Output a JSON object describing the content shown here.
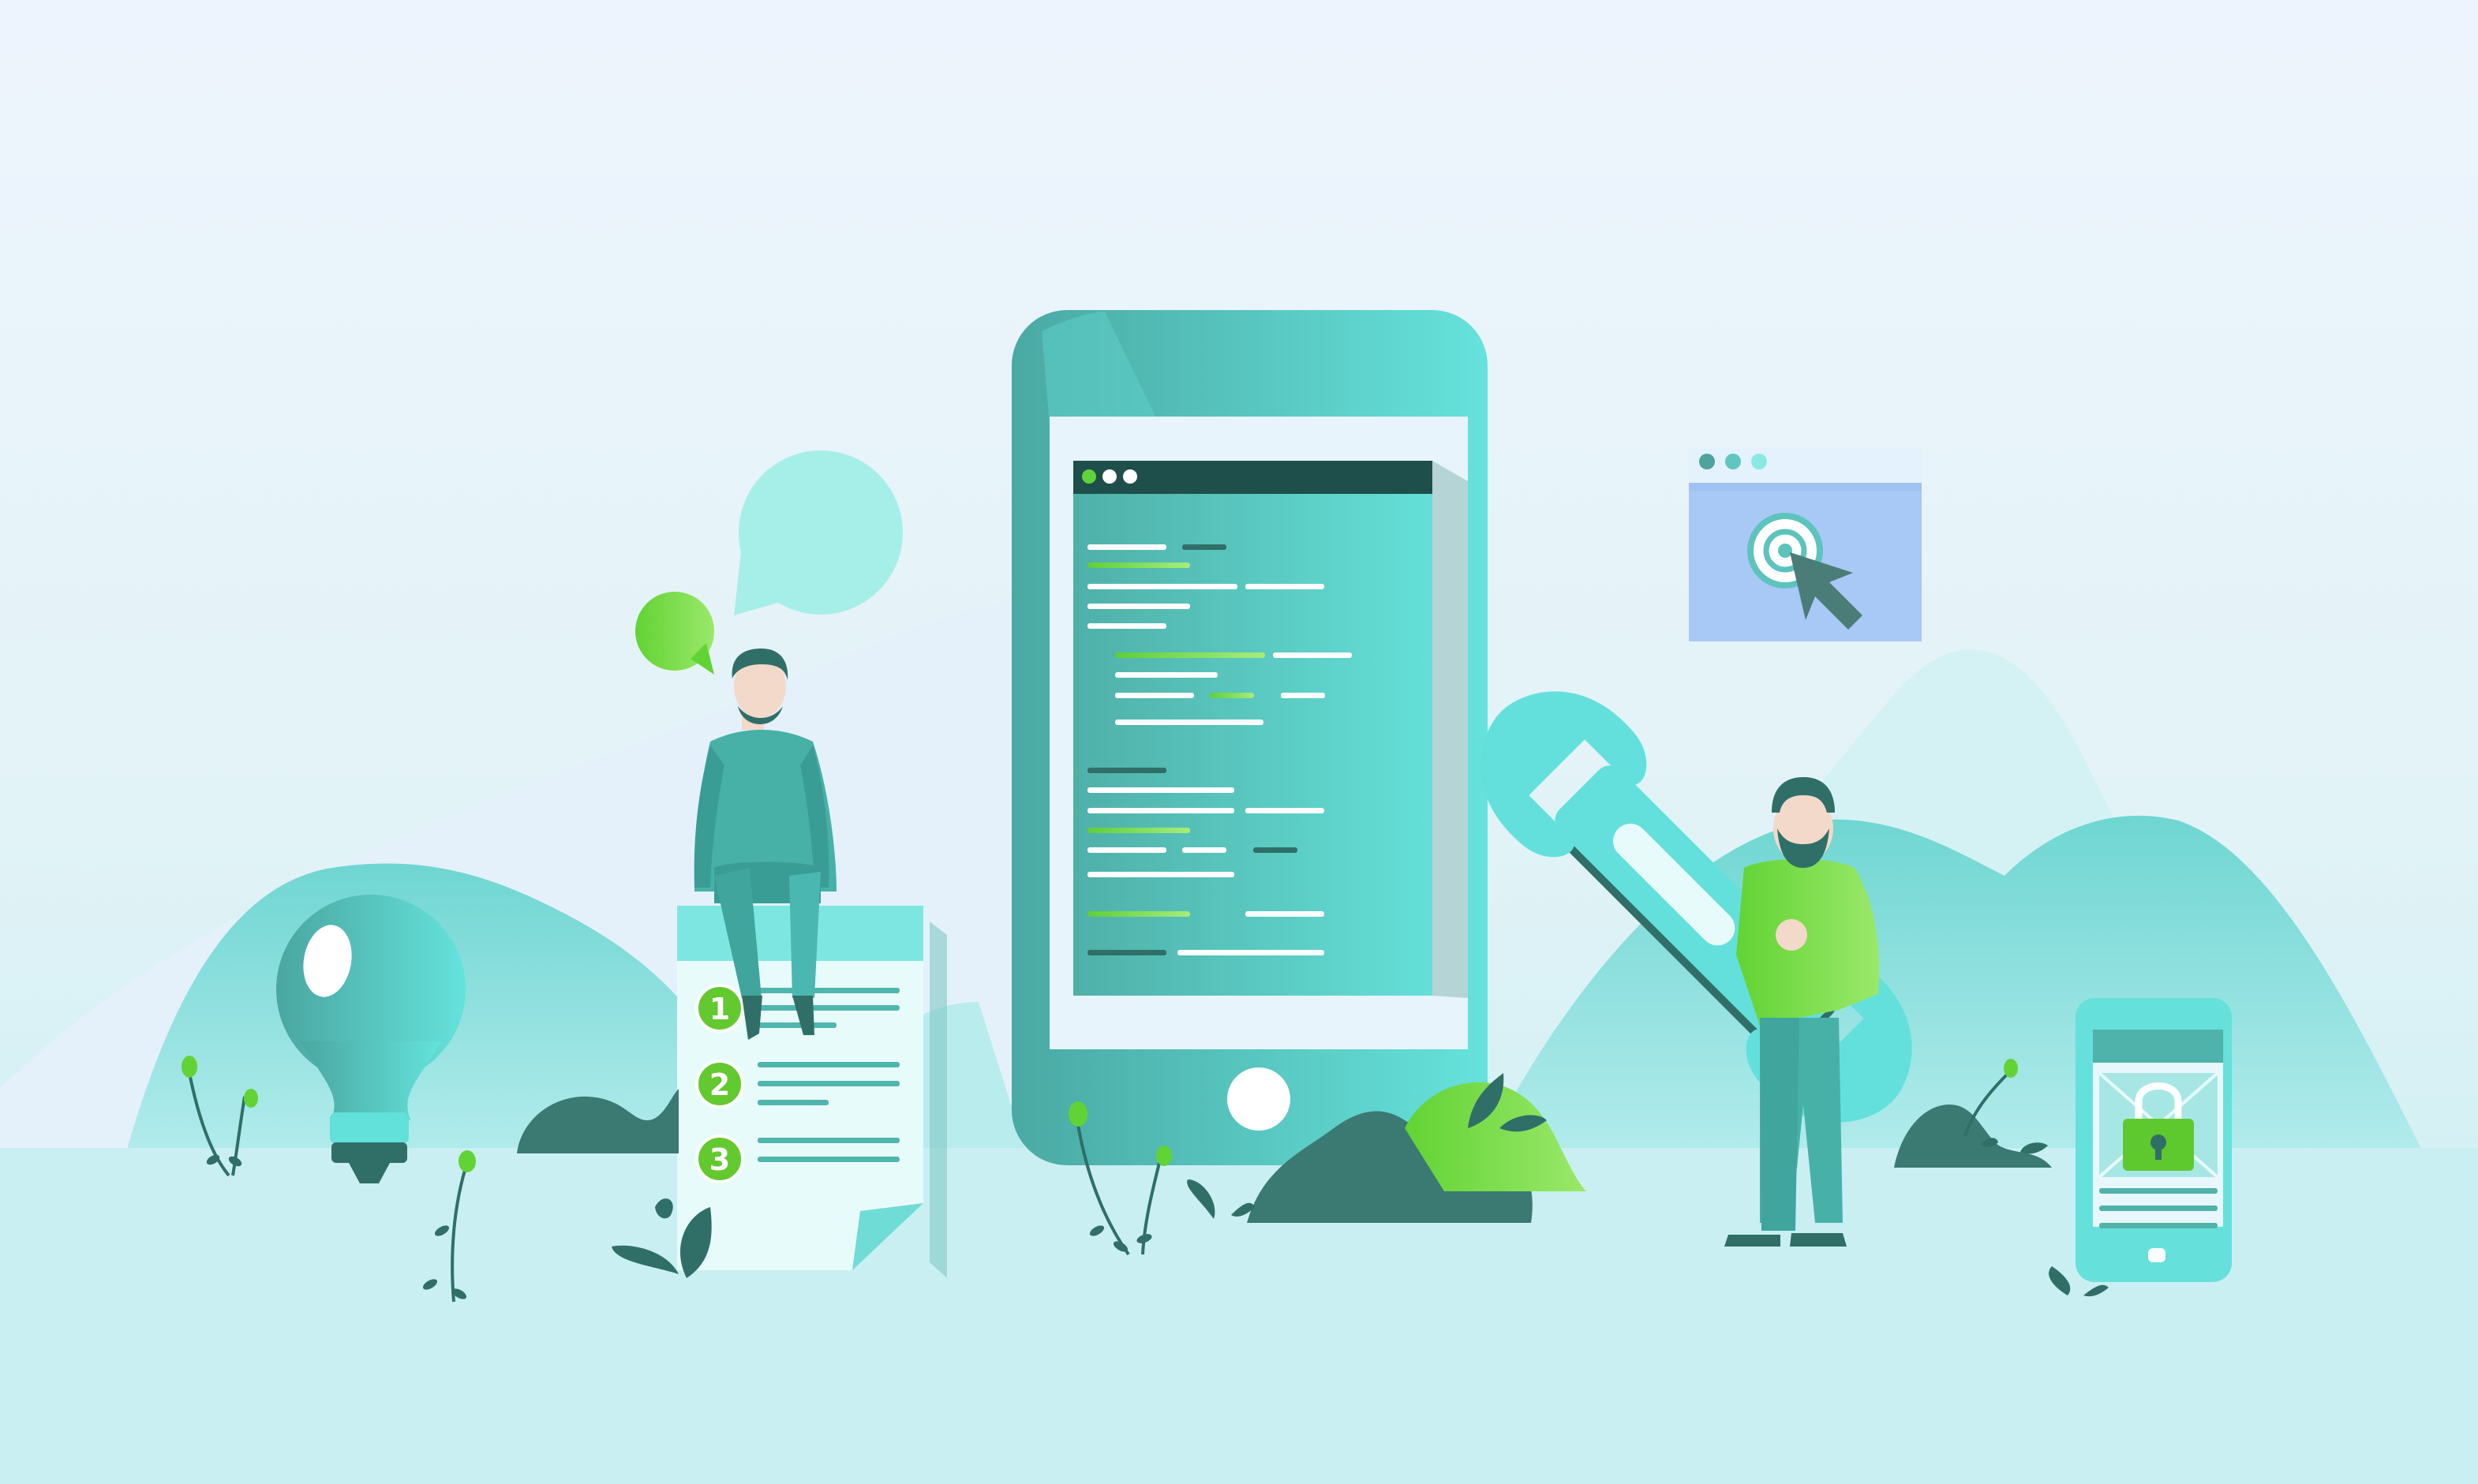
{
  "checklist": {
    "step_numbers": [
      "1",
      "2",
      "3"
    ]
  },
  "colors": {
    "background_top": "#eef4fd",
    "background_bottom": "#c7eef1",
    "teal": "#4fb8b0",
    "light_teal": "#64e0dc",
    "dark_teal": "#3d7a72",
    "green": "#62d334",
    "blue_window": "#a8c8f5"
  },
  "icons": [
    "lightbulb-icon",
    "chat-bubble-icon",
    "checklist-icon",
    "smartphone-icon",
    "code-editor-icon",
    "wrench-icon",
    "browser-window-icon",
    "target-icon",
    "cursor-arrow-icon",
    "mobile-lock-icon",
    "padlock-icon"
  ]
}
